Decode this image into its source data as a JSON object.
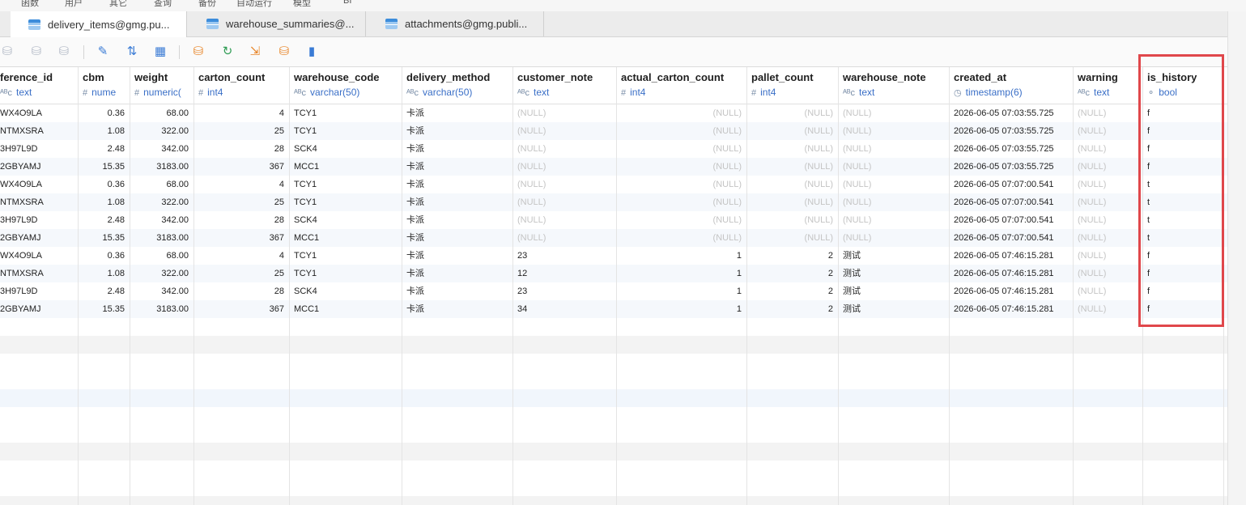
{
  "menu": [
    "函数",
    "用户",
    "其它",
    "查询",
    "备份",
    "自动运行",
    "模型",
    "BI"
  ],
  "tabs": [
    {
      "label": "delivery_items@gmg.pu...",
      "active": true
    },
    {
      "label": "warehouse_summaries@...",
      "active": false
    },
    {
      "label": "attachments@gmg.publi...",
      "active": false
    }
  ],
  "toolbar": [
    {
      "name": "add-record-icon",
      "glyph": "⛁",
      "tone": "dim"
    },
    {
      "name": "commit-icon",
      "glyph": "⛁",
      "tone": "dim"
    },
    {
      "name": "discard-icon",
      "glyph": "⛁",
      "tone": "dim"
    },
    {
      "name": "edit-icon",
      "glyph": "✎",
      "tone": "blue"
    },
    {
      "name": "filter-sort-icon",
      "glyph": "⇅",
      "tone": "blue"
    },
    {
      "name": "grid-view-icon",
      "glyph": "▦",
      "tone": "blue"
    },
    {
      "name": "import-icon",
      "glyph": "⛁",
      "tone": "orange"
    },
    {
      "name": "refresh-icon",
      "glyph": "↻",
      "tone": "green"
    },
    {
      "name": "export-icon",
      "glyph": "⇲",
      "tone": "orange"
    },
    {
      "name": "export-data-icon",
      "glyph": "⛁",
      "tone": "orange"
    },
    {
      "name": "chart-icon",
      "glyph": "▮",
      "tone": "blue"
    }
  ],
  "columns": [
    {
      "name": "ference_id",
      "type": "text",
      "type_icon": "ᴬᴮᴄ"
    },
    {
      "name": "cbm",
      "type": "nume",
      "type_icon": "#"
    },
    {
      "name": "weight",
      "type": "numeric(",
      "type_icon": "#"
    },
    {
      "name": "carton_count",
      "type": "int4",
      "type_icon": "#"
    },
    {
      "name": "warehouse_code",
      "type": "varchar(50)",
      "type_icon": "ᴬᴮᴄ"
    },
    {
      "name": "delivery_method",
      "type": "varchar(50)",
      "type_icon": "ᴬᴮᴄ"
    },
    {
      "name": "customer_note",
      "type": "text",
      "type_icon": "ᴬᴮᴄ"
    },
    {
      "name": "actual_carton_count",
      "type": "int4",
      "type_icon": "#"
    },
    {
      "name": "pallet_count",
      "type": "int4",
      "type_icon": "#"
    },
    {
      "name": "warehouse_note",
      "type": "text",
      "type_icon": "ᴬᴮᴄ"
    },
    {
      "name": "created_at",
      "type": "timestamp(6)",
      "type_icon": "◷"
    },
    {
      "name": "warning",
      "type": "text",
      "type_icon": "ᴬᴮᴄ"
    },
    {
      "name": "is_history",
      "type": "bool",
      "type_icon": "⚬"
    }
  ],
  "rows": [
    [
      "WX4O9LA",
      "0.36",
      "68.00",
      "4",
      "TCY1",
      "卡派",
      "(NULL)",
      "(NULL)",
      "(NULL)",
      "(NULL)",
      "2026-06-05 07:03:55.725",
      "(NULL)",
      "f"
    ],
    [
      "NTMXSRA",
      "1.08",
      "322.00",
      "25",
      "TCY1",
      "卡派",
      "(NULL)",
      "(NULL)",
      "(NULL)",
      "(NULL)",
      "2026-06-05 07:03:55.725",
      "(NULL)",
      "f"
    ],
    [
      "3H97L9D",
      "2.48",
      "342.00",
      "28",
      "SCK4",
      "卡派",
      "(NULL)",
      "(NULL)",
      "(NULL)",
      "(NULL)",
      "2026-06-05 07:03:55.725",
      "(NULL)",
      "f"
    ],
    [
      "2GBYAMJ",
      "15.35",
      "3183.00",
      "367",
      "MCC1",
      "卡派",
      "(NULL)",
      "(NULL)",
      "(NULL)",
      "(NULL)",
      "2026-06-05 07:03:55.725",
      "(NULL)",
      "f"
    ],
    [
      "WX4O9LA",
      "0.36",
      "68.00",
      "4",
      "TCY1",
      "卡派",
      "(NULL)",
      "(NULL)",
      "(NULL)",
      "(NULL)",
      "2026-06-05 07:07:00.541",
      "(NULL)",
      "t"
    ],
    [
      "NTMXSRA",
      "1.08",
      "322.00",
      "25",
      "TCY1",
      "卡派",
      "(NULL)",
      "(NULL)",
      "(NULL)",
      "(NULL)",
      "2026-06-05 07:07:00.541",
      "(NULL)",
      "t"
    ],
    [
      "3H97L9D",
      "2.48",
      "342.00",
      "28",
      "SCK4",
      "卡派",
      "(NULL)",
      "(NULL)",
      "(NULL)",
      "(NULL)",
      "2026-06-05 07:07:00.541",
      "(NULL)",
      "t"
    ],
    [
      "2GBYAMJ",
      "15.35",
      "3183.00",
      "367",
      "MCC1",
      "卡派",
      "(NULL)",
      "(NULL)",
      "(NULL)",
      "(NULL)",
      "2026-06-05 07:07:00.541",
      "(NULL)",
      "t"
    ],
    [
      "WX4O9LA",
      "0.36",
      "68.00",
      "4",
      "TCY1",
      "卡派",
      "23",
      "1",
      "2",
      "测试",
      "2026-06-05 07:46:15.281",
      "(NULL)",
      "f"
    ],
    [
      "NTMXSRA",
      "1.08",
      "322.00",
      "25",
      "TCY1",
      "卡派",
      "12",
      "1",
      "2",
      "测试",
      "2026-06-05 07:46:15.281",
      "(NULL)",
      "f"
    ],
    [
      "3H97L9D",
      "2.48",
      "342.00",
      "28",
      "SCK4",
      "卡派",
      "23",
      "1",
      "2",
      "测试",
      "2026-06-05 07:46:15.281",
      "(NULL)",
      "f"
    ],
    [
      "2GBYAMJ",
      "15.35",
      "3183.00",
      "367",
      "MCC1",
      "卡派",
      "34",
      "1",
      "2",
      "测试",
      "2026-06-05 07:46:15.281",
      "(NULL)",
      "f"
    ]
  ],
  "colors": {
    "highlight": "#e0474b",
    "type_text": "#3a6fc7",
    "null_text": "#c4c4c4"
  }
}
